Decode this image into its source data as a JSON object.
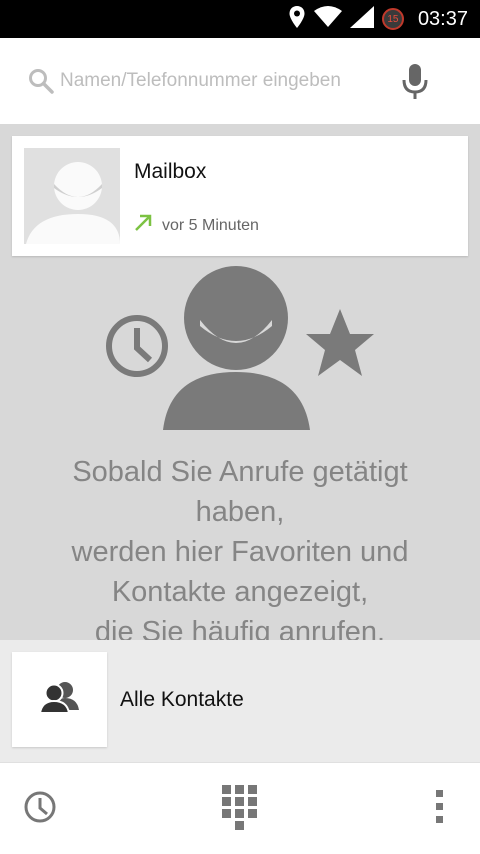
{
  "status_bar": {
    "time": "03:37",
    "notification_count": "15",
    "icons": [
      "location-icon",
      "wifi-icon",
      "signal-icon"
    ]
  },
  "search": {
    "placeholder": "Namen/Telefonnummer eingeben",
    "icons": [
      "search-icon",
      "mic-icon"
    ]
  },
  "recent_call": {
    "name": "Mailbox",
    "time_ago": "vor 5 Minuten",
    "call_type_icon": "outgoing-call-arrow-icon"
  },
  "empty_state": {
    "lines": [
      "Sobald Sie Anrufe getätigt",
      "haben,",
      "werden hier Favoriten und",
      "Kontakte angezeigt,",
      "die Sie häufig anrufen."
    ],
    "icons": [
      "history-clock-icon",
      "person-icon",
      "star-icon"
    ]
  },
  "all_contacts": {
    "label": "Alle Kontakte",
    "icon": "contacts-icon"
  },
  "bottom_bar": {
    "icons": [
      "call-history-icon",
      "dialpad-icon",
      "overflow-menu-icon"
    ]
  },
  "colors": {
    "accent_green": "#7cc242",
    "placeholder": "#bdbdbd",
    "icon_gray": "#777777"
  }
}
